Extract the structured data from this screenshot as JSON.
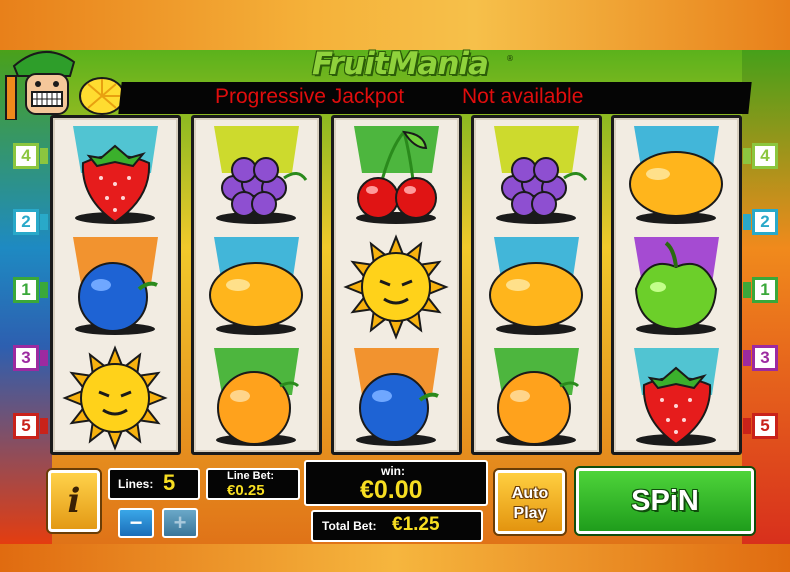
{
  "logo": {
    "text": "FruitMania",
    "tm": "®"
  },
  "jackpot": {
    "label": "Progressive Jackpot",
    "value": "Not available"
  },
  "reels": [
    [
      "strawberry",
      "plum",
      "sun"
    ],
    [
      "grapes",
      "lemon",
      "orange"
    ],
    [
      "cherries",
      "sun",
      "plum"
    ],
    [
      "grapes",
      "lemon",
      "orange"
    ],
    [
      "lemon",
      "apple",
      "strawberry"
    ]
  ],
  "line_markers": {
    "left": [
      "4",
      "2",
      "1",
      "3",
      "5"
    ],
    "right": [
      "4",
      "2",
      "1",
      "3",
      "5"
    ]
  },
  "controls": {
    "info_label": "i",
    "lines_label": "Lines:",
    "lines_value": "5",
    "minus_label": "−",
    "plus_label": "+",
    "line_bet_label": "Line Bet:",
    "line_bet_value": "€0.25",
    "win_label": "win:",
    "win_value": "€0.00",
    "total_bet_label": "Total Bet:",
    "total_bet_value": "€1.25",
    "autoplay_line1": "Auto",
    "autoplay_line2": "Play",
    "spin_label": "SPiN"
  },
  "colors": {
    "jackpot_text": "#e00d0d",
    "value_text": "#f7de22",
    "line_4": "#8cc63f",
    "line_2": "#29a9c9",
    "line_1": "#3aa83a",
    "line_3": "#9c2aa0",
    "line_5": "#c9221a"
  },
  "icons": {
    "symbols": [
      "strawberry-icon",
      "plum-icon",
      "sun-icon",
      "grapes-icon",
      "lemon-icon",
      "orange-icon",
      "cherries-icon",
      "apple-icon"
    ]
  }
}
